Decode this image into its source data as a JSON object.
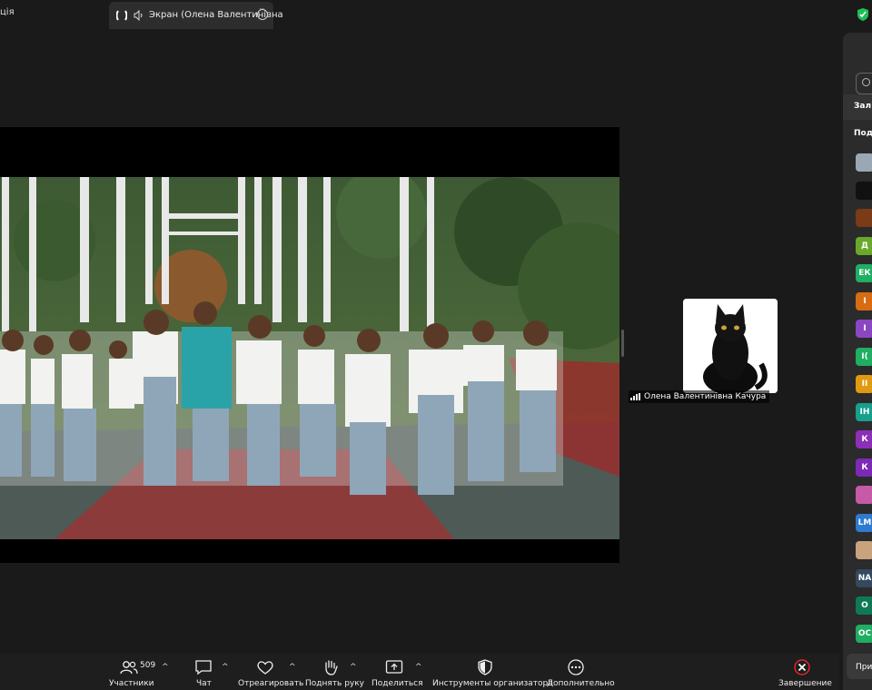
{
  "tabs": {
    "left_label": "ція",
    "active_label": "Экран (Олена Валентинівна"
  },
  "self_view": {
    "name": "Олена Валентинівна Качура"
  },
  "sidebar": {
    "hall_label": "Зал",
    "sub_label": "Под",
    "bottom_label": "При",
    "avatars": [
      {
        "initials": "",
        "color": "#9aa7b5"
      },
      {
        "initials": "",
        "color": "#111111"
      },
      {
        "initials": "",
        "color": "#7a3b16"
      },
      {
        "initials": "Д",
        "color": "#6aa82b"
      },
      {
        "initials": "ЕК",
        "color": "#1fae62"
      },
      {
        "initials": "І",
        "color": "#d86c12"
      },
      {
        "initials": "І",
        "color": "#8b46c2"
      },
      {
        "initials": "І(",
        "color": "#1fae62"
      },
      {
        "initials": "ІІ",
        "color": "#e09a10"
      },
      {
        "initials": "ІН",
        "color": "#16a08e"
      },
      {
        "initials": "К",
        "color": "#8b2fb8"
      },
      {
        "initials": "К",
        "color": "#7b2ab5"
      },
      {
        "initials": "",
        "color": "#c65aa7"
      },
      {
        "initials": "LM",
        "color": "#2e7bd1"
      },
      {
        "initials": "",
        "color": "#c9a27e"
      },
      {
        "initials": "NA",
        "color": "#34495e"
      },
      {
        "initials": "О",
        "color": "#0e7a55"
      },
      {
        "initials": "ОС",
        "color": "#1fae62"
      }
    ]
  },
  "toolbar": {
    "participants_label": "Участники",
    "participants_count": "509",
    "chat_label": "Чат",
    "react_label": "Отреагировать",
    "raise_hand_label": "Поднять руку",
    "share_label": "Поделиться",
    "host_tools_label": "Инструменты организатора",
    "more_label": "Дополнительно",
    "end_label": "Завершение"
  }
}
